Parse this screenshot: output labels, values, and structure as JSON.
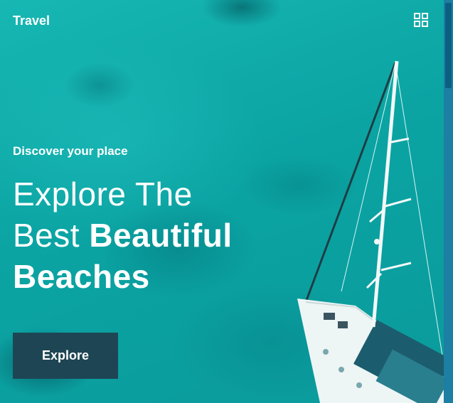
{
  "header": {
    "brand": "Travel",
    "menu_icon": "grid-icon"
  },
  "hero": {
    "eyebrow": "Discover your place",
    "headline": {
      "line1": "Explore The",
      "line2_regular": "Best",
      "line2_bold": "Beautiful",
      "line3_bold": "Beaches"
    },
    "cta_label": "Explore"
  },
  "colors": {
    "water": "#0aa9a6",
    "cta_background": "#1e4554",
    "text": "#ffffff",
    "scrollbar": "#1c7fa3"
  }
}
